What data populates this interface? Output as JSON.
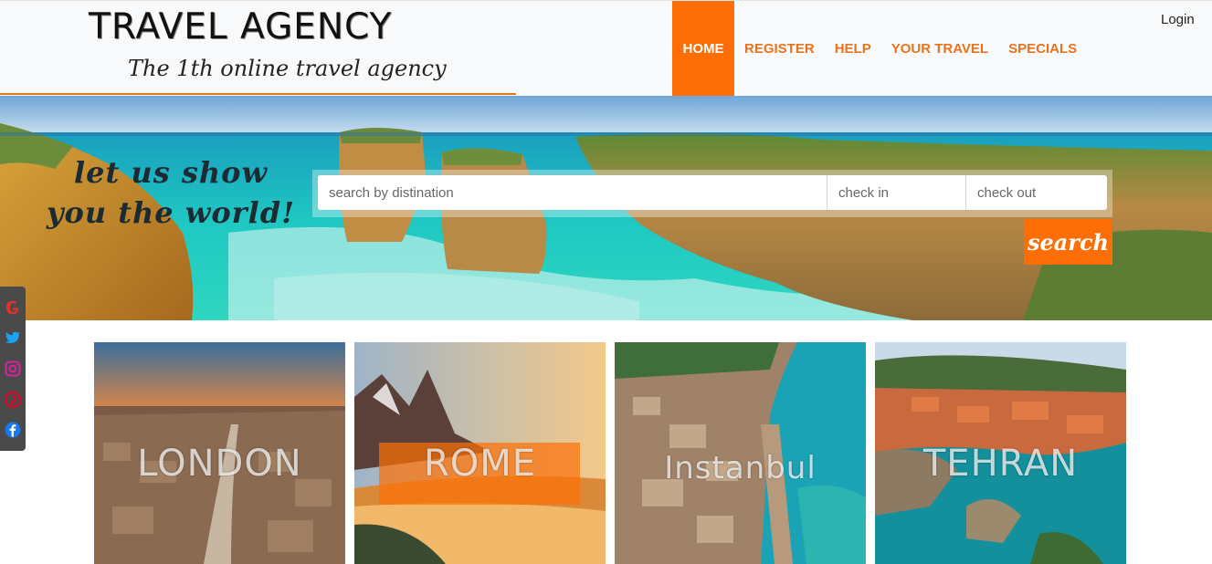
{
  "brand": {
    "title": "TRAVEL AGENCY",
    "subtitle": "The 1th online travel agency"
  },
  "nav": {
    "items": [
      {
        "label": "HOME",
        "active": true
      },
      {
        "label": "REGISTER"
      },
      {
        "label": "HELP"
      },
      {
        "label": "YOUR TRAVEL"
      },
      {
        "label": "SPECIALS"
      }
    ],
    "login": "Login"
  },
  "hero": {
    "tagline": "let us show you the world!",
    "search": {
      "destination_placeholder": "search by distination",
      "checkin_placeholder": "check in",
      "checkout_placeholder": "check out",
      "button_label": "search"
    }
  },
  "social": {
    "icons": [
      "google-icon",
      "twitter-icon",
      "instagram-icon",
      "pinterest-icon",
      "facebook-icon"
    ]
  },
  "cities": [
    {
      "label": "LONDON"
    },
    {
      "label": "ROME"
    },
    {
      "label": "Instanbul"
    },
    {
      "label": "TEHRAN"
    }
  ],
  "colors": {
    "accent": "#fd6f06",
    "nav_text": "#e8731c",
    "header_bg": "#f8f9fa",
    "social_bg": "#4a4a4a"
  }
}
